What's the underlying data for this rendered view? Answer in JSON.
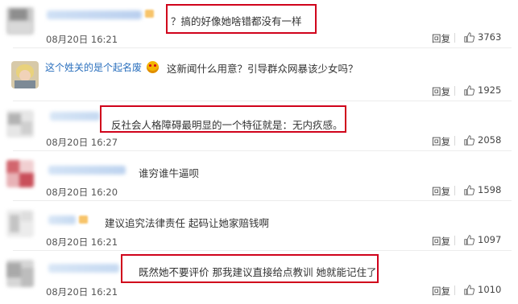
{
  "comments": [
    {
      "username": "",
      "text": "？搞的好像她啥错都没有一样",
      "time": "08月20日 16:21",
      "reply": "回复",
      "likes": "3763",
      "highlighted": true
    },
    {
      "username": "这个姓关的是个起名废",
      "text": "这新闻什么用意？引导群众网暴该少女吗？",
      "time": "",
      "reply": "回复",
      "likes": "1925",
      "highlighted": false
    },
    {
      "username": "",
      "text": "反社会人格障碍最明显的一个特征就是：无内疚感。",
      "time": "08月20日 16:27",
      "reply": "回复",
      "likes": "2058",
      "highlighted": true
    },
    {
      "username": "",
      "text": "谁穷谁牛逼呗",
      "time": "08月20日 16:20",
      "reply": "回复",
      "likes": "1598",
      "highlighted": false
    },
    {
      "username": "",
      "text": "建议追究法律责任 起码让她家赔钱啊",
      "time": "08月20日 16:21",
      "reply": "回复",
      "likes": "1097",
      "highlighted": false
    },
    {
      "username": "",
      "text": "既然她不要评价 那我建议直接给点教训 她就能记住了",
      "time": "08月20日 16:21",
      "reply": "回复",
      "likes": "1010",
      "highlighted": true
    }
  ],
  "icons": {
    "like": "thumbs-up-icon",
    "emoji": "heart-eyes-emoji-icon"
  },
  "colors": {
    "highlight": "#d0021b",
    "username": "#2a6fbd"
  }
}
